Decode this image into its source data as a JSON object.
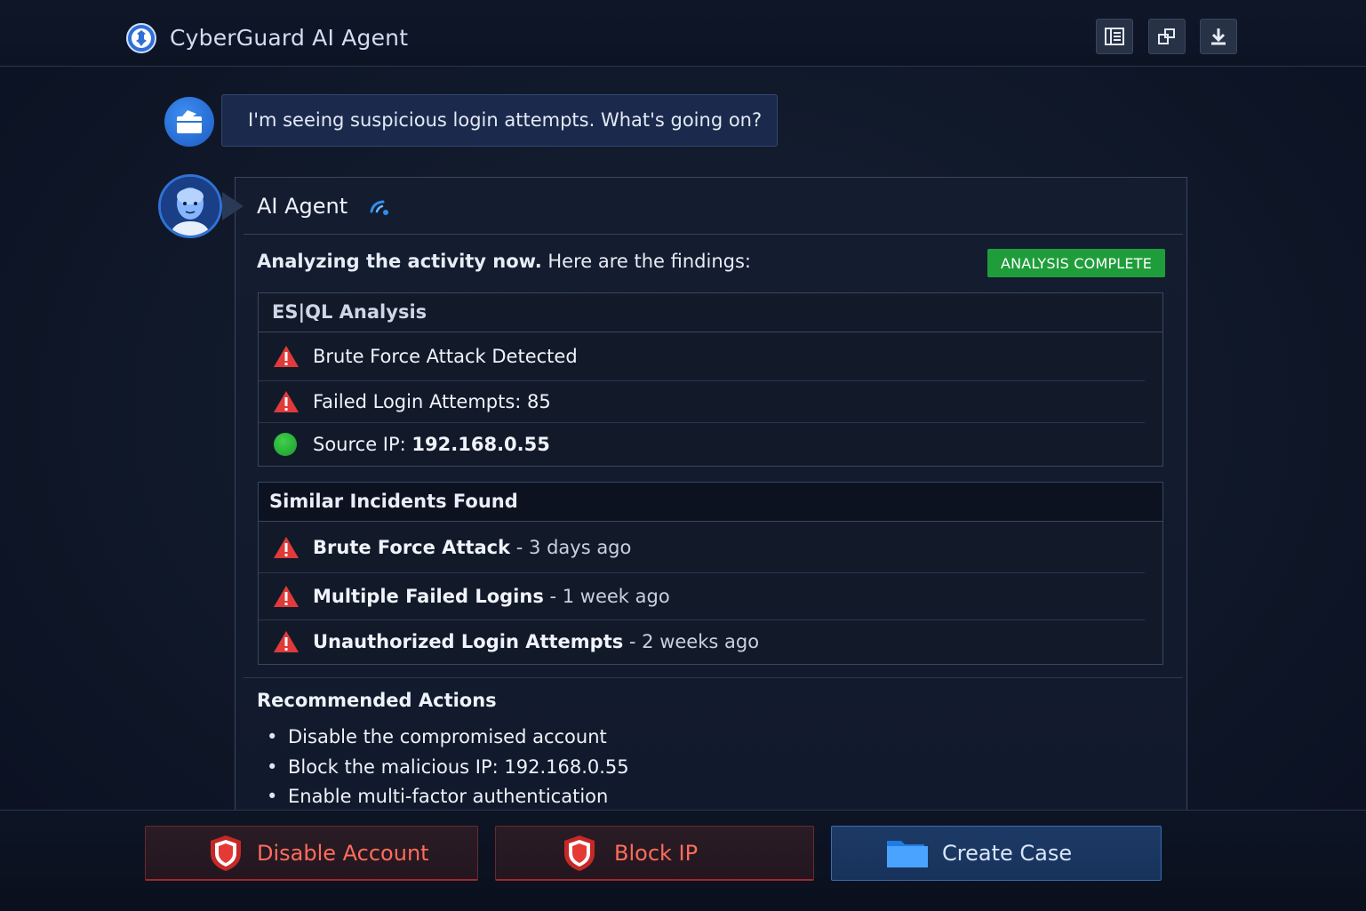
{
  "header": {
    "app_title": "CyberGuard AI Agent",
    "tools": [
      {
        "icon": "list-view-icon"
      },
      {
        "icon": "expand-window-icon"
      },
      {
        "icon": "download-icon"
      }
    ]
  },
  "conversation": {
    "user_message": "I'm seeing suspicious login attempts. What's going on?",
    "agent": {
      "name": "AI Agent",
      "intro_bold": "Analyzing the activity now.",
      "intro_rest": " Here are the findings:",
      "status": "ANALYSIS COMPLETE"
    }
  },
  "esql_panel": {
    "title": "ES|QL Analysis",
    "items": [
      {
        "icon": "warning-icon",
        "text": "Brute Force Attack Detected"
      },
      {
        "icon": "warning-icon",
        "text": "Failed Login Attempts: 85"
      },
      {
        "icon": "green-status-dot",
        "label": "Source IP: ",
        "value": "192.168.0.55"
      }
    ]
  },
  "incidents_panel": {
    "title": "Similar Incidents Found",
    "items": [
      {
        "name": "Brute Force Attack",
        "when": " - 3 days ago"
      },
      {
        "name": "Multiple Failed Logins",
        "when": " - 1 week ago"
      },
      {
        "name": "Unauthorized Login Attempts",
        "when": " - 2 weeks ago"
      }
    ]
  },
  "recommendations": {
    "title": "Recommended Actions",
    "items": [
      "Disable the compromised account",
      "Block the malicious IP: 192.168.0.55",
      "Enable multi-factor authentication"
    ]
  },
  "actions": {
    "disable_account": "Disable Account",
    "block_ip": "Block IP",
    "create_case": "Create Case"
  },
  "colors": {
    "background": "#111a2b",
    "accent_blue": "#2f72d4",
    "success_green": "#1f9d3a",
    "danger_red": "#e03a3a"
  }
}
